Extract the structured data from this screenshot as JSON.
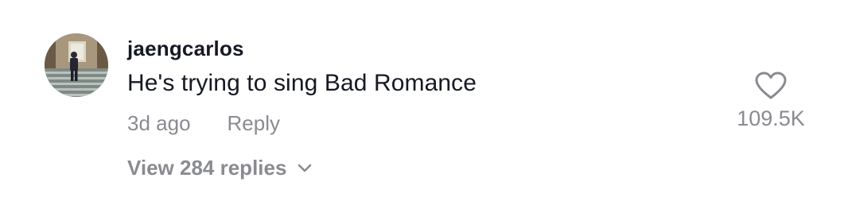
{
  "comment": {
    "username": "jaengcarlos",
    "text": "He's trying to sing Bad Romance",
    "timestamp": "3d ago",
    "reply_label": "Reply",
    "view_replies_label": "View 284 replies",
    "like_count": "109.5K"
  },
  "icons": {
    "like": "heart-outline-icon",
    "expand": "chevron-down-icon"
  },
  "colors": {
    "primary_text": "#161823",
    "secondary_text": "#8a8b91",
    "background": "#ffffff"
  }
}
